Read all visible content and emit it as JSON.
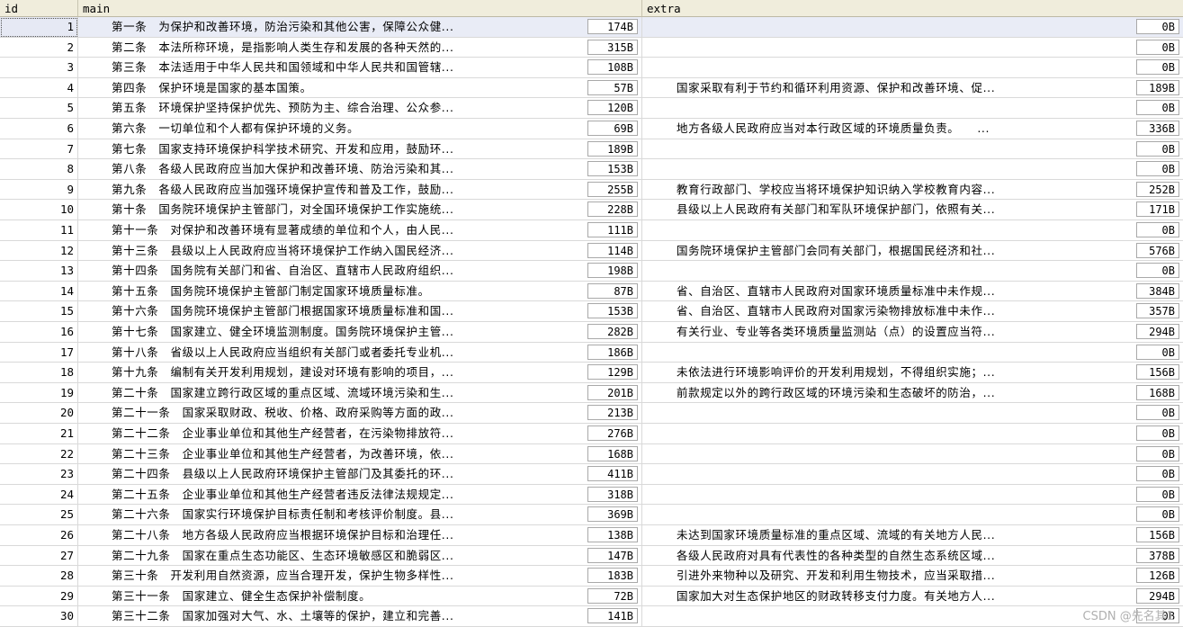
{
  "columns": {
    "id": "id",
    "main": "main",
    "extra": "extra"
  },
  "rows": [
    {
      "id": "1",
      "main": "第一条　为保护和改善环境，防治污染和其他公害，保障公众健...",
      "main_size": "174B",
      "extra": "",
      "extra_size": "0B"
    },
    {
      "id": "2",
      "main": "第二条　本法所称环境，是指影响人类生存和发展的各种天然的...",
      "main_size": "315B",
      "extra": "",
      "extra_size": "0B"
    },
    {
      "id": "3",
      "main": "第三条　本法适用于中华人民共和国领域和中华人民共和国管辖...",
      "main_size": "108B",
      "extra": "",
      "extra_size": "0B"
    },
    {
      "id": "4",
      "main": "第四条　保护环境是国家的基本国策。",
      "main_size": "57B",
      "extra": "国家采取有利于节约和循环利用资源、保护和改善环境、促...",
      "extra_size": "189B"
    },
    {
      "id": "5",
      "main": "第五条　环境保护坚持保护优先、预防为主、综合治理、公众参...",
      "main_size": "120B",
      "extra": "",
      "extra_size": "0B"
    },
    {
      "id": "6",
      "main": "第六条　一切单位和个人都有保护环境的义务。",
      "main_size": "69B",
      "extra": "地方各级人民政府应当对本行政区域的环境质量负责。　　...",
      "extra_size": "336B"
    },
    {
      "id": "7",
      "main": "第七条　国家支持环境保护科学技术研究、开发和应用，鼓励环...",
      "main_size": "189B",
      "extra": "",
      "extra_size": "0B"
    },
    {
      "id": "8",
      "main": "第八条　各级人民政府应当加大保护和改善环境、防治污染和其...",
      "main_size": "153B",
      "extra": "",
      "extra_size": "0B"
    },
    {
      "id": "9",
      "main": "第九条　各级人民政府应当加强环境保护宣传和普及工作，鼓励...",
      "main_size": "255B",
      "extra": "教育行政部门、学校应当将环境保护知识纳入学校教育内容...",
      "extra_size": "252B"
    },
    {
      "id": "10",
      "main": "第十条　国务院环境保护主管部门，对全国环境保护工作实施统...",
      "main_size": "228B",
      "extra": "县级以上人民政府有关部门和军队环境保护部门，依照有关...",
      "extra_size": "171B"
    },
    {
      "id": "11",
      "main": "第十一条　对保护和改善环境有显著成绩的单位和个人，由人民...",
      "main_size": "111B",
      "extra": "",
      "extra_size": "0B"
    },
    {
      "id": "12",
      "main": "第十三条　县级以上人民政府应当将环境保护工作纳入国民经济...",
      "main_size": "114B",
      "extra": "国务院环境保护主管部门会同有关部门，根据国民经济和社...",
      "extra_size": "576B"
    },
    {
      "id": "13",
      "main": "第十四条　国务院有关部门和省、自治区、直辖市人民政府组织...",
      "main_size": "198B",
      "extra": "",
      "extra_size": "0B"
    },
    {
      "id": "14",
      "main": "第十五条　国务院环境保护主管部门制定国家环境质量标准。",
      "main_size": "87B",
      "extra": "省、自治区、直辖市人民政府对国家环境质量标准中未作规...",
      "extra_size": "384B"
    },
    {
      "id": "15",
      "main": "第十六条　国务院环境保护主管部门根据国家环境质量标准和国...",
      "main_size": "153B",
      "extra": "省、自治区、直辖市人民政府对国家污染物排放标准中未作...",
      "extra_size": "357B"
    },
    {
      "id": "16",
      "main": "第十七条　国家建立、健全环境监测制度。国务院环境保护主管...",
      "main_size": "282B",
      "extra": "有关行业、专业等各类环境质量监测站（点）的设置应当符...",
      "extra_size": "294B"
    },
    {
      "id": "17",
      "main": "第十八条　省级以上人民政府应当组织有关部门或者委托专业机...",
      "main_size": "186B",
      "extra": "",
      "extra_size": "0B"
    },
    {
      "id": "18",
      "main": "第十九条　编制有关开发利用规划，建设对环境有影响的项目，...",
      "main_size": "129B",
      "extra": "未依法进行环境影响评价的开发利用规划，不得组织实施；...",
      "extra_size": "156B"
    },
    {
      "id": "19",
      "main": "第二十条　国家建立跨行政区域的重点区域、流域环境污染和生...",
      "main_size": "201B",
      "extra": "前款规定以外的跨行政区域的环境污染和生态破坏的防治，...",
      "extra_size": "168B"
    },
    {
      "id": "20",
      "main": "第二十一条　国家采取财政、税收、价格、政府采购等方面的政...",
      "main_size": "213B",
      "extra": "",
      "extra_size": "0B"
    },
    {
      "id": "21",
      "main": "第二十二条　企业事业单位和其他生产经营者，在污染物排放符...",
      "main_size": "276B",
      "extra": "",
      "extra_size": "0B"
    },
    {
      "id": "22",
      "main": "第二十三条　企业事业单位和其他生产经营者，为改善环境，依...",
      "main_size": "168B",
      "extra": "",
      "extra_size": "0B"
    },
    {
      "id": "23",
      "main": "第二十四条　县级以上人民政府环境保护主管部门及其委托的环...",
      "main_size": "411B",
      "extra": "",
      "extra_size": "0B"
    },
    {
      "id": "24",
      "main": "第二十五条　企业事业单位和其他生产经营者违反法律法规规定...",
      "main_size": "318B",
      "extra": "",
      "extra_size": "0B"
    },
    {
      "id": "25",
      "main": "第二十六条　国家实行环境保护目标责任制和考核评价制度。县...",
      "main_size": "369B",
      "extra": "",
      "extra_size": "0B"
    },
    {
      "id": "26",
      "main": "第二十八条　地方各级人民政府应当根据环境保护目标和治理任...",
      "main_size": "138B",
      "extra": "未达到国家环境质量标准的重点区域、流域的有关地方人民...",
      "extra_size": "156B"
    },
    {
      "id": "27",
      "main": "第二十九条　国家在重点生态功能区、生态环境敏感区和脆弱区...",
      "main_size": "147B",
      "extra": "各级人民政府对具有代表性的各种类型的自然生态系统区域...",
      "extra_size": "378B"
    },
    {
      "id": "28",
      "main": "第三十条　开发利用自然资源，应当合理开发，保护生物多样性...",
      "main_size": "183B",
      "extra": "引进外来物种以及研究、开发和利用生物技术，应当采取措...",
      "extra_size": "126B"
    },
    {
      "id": "29",
      "main": "第三十一条　国家建立、健全生态保护补偿制度。",
      "main_size": "72B",
      "extra": "国家加大对生态保护地区的财政转移支付力度。有关地方人...",
      "extra_size": "294B"
    },
    {
      "id": "30",
      "main": "第三十二条　国家加强对大气、水、土壤等的保护，建立和完善...",
      "main_size": "141B",
      "extra": "",
      "extra_size": "0B"
    }
  ],
  "watermark": "CSDN @先名其1"
}
